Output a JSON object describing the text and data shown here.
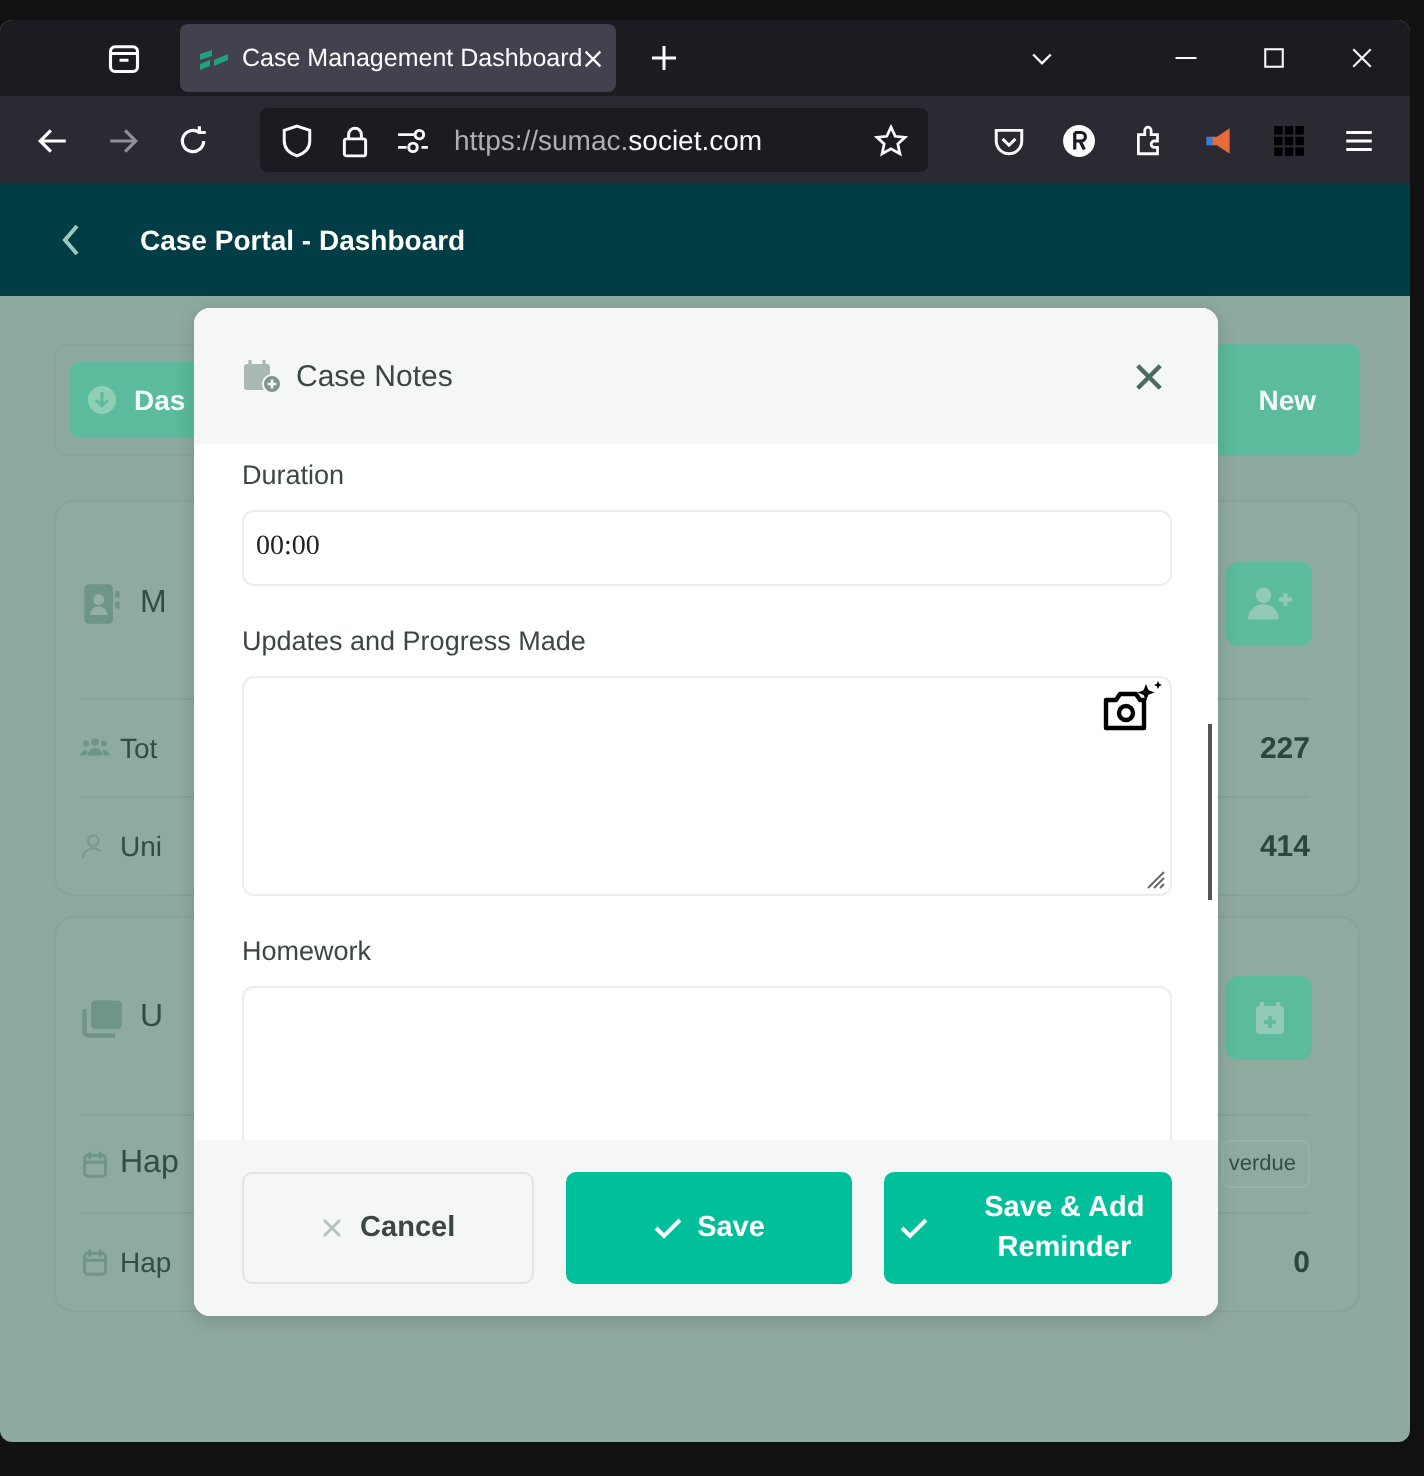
{
  "browser": {
    "tab": {
      "title": "Case Management Dashboard",
      "selected": true
    },
    "url": {
      "prefix": "https://sumac.",
      "domain": "societ.com"
    }
  },
  "app_header": {
    "title": "Case Portal - Dashboard"
  },
  "background": {
    "top_buttons": [
      {
        "label": "Das"
      },
      {
        "label": "New"
      }
    ],
    "cards": [
      {
        "header": "M",
        "kind": "people",
        "rows": [
          {
            "label": "Tot",
            "value": "227"
          },
          {
            "label": "Uni",
            "value": "414"
          }
        ]
      },
      {
        "header": "U",
        "kind": "calendar",
        "rows": [
          {
            "label": "Hap",
            "badge": "verdue"
          },
          {
            "label": "Hap",
            "value": "0"
          }
        ]
      }
    ]
  },
  "modal": {
    "title": "Case Notes",
    "fields": [
      {
        "label": "Duration",
        "kind": "input",
        "value": "00:00"
      },
      {
        "label": "Updates and Progress Made",
        "kind": "textarea",
        "camera_button": true
      },
      {
        "label": "Homework",
        "kind": "textarea",
        "camera_button": false
      }
    ],
    "buttons": [
      {
        "label": "Cancel",
        "kind": "secondary"
      },
      {
        "label": "Save",
        "kind": "primary"
      },
      {
        "label": "Save & Add Reminder",
        "kind": "primary"
      }
    ]
  }
}
